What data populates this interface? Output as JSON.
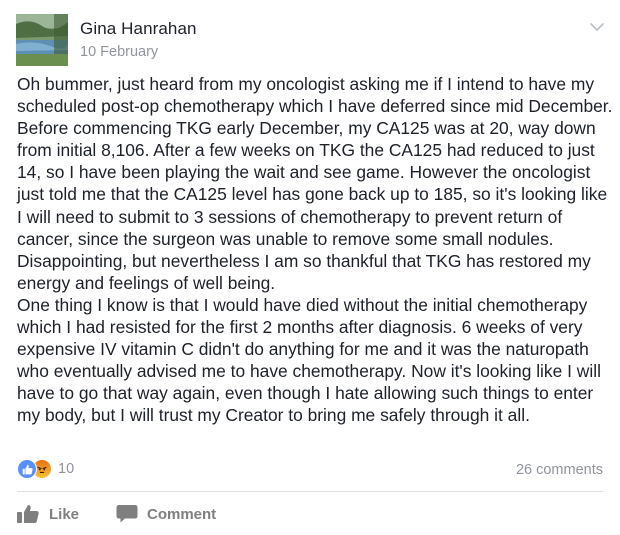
{
  "post": {
    "author": "Gina Hanrahan",
    "date": "10 February",
    "paragraphs": [
      "Oh bummer, just heard from my oncologist asking me if I intend to have my scheduled post-op chemotherapy which I have deferred since mid December. Before commencing TKG early December, my CA125 was at 20, way down from initial 8,106. After a few weeks on TKG the CA125 had reduced to just 14, so I have been playing the wait and see game. However the oncologist just told me that the CA125 level has gone back up to 185, so it's looking like I will need to submit to 3 sessions of chemotherapy to prevent return of cancer, since the surgeon was unable to remove some small nodules.",
      "Disappointing, but nevertheless I am so thankful that TKG has restored my energy and feelings of well being.",
      "One thing I know is that I would have died without the initial chemotherapy which I had resisted for the first 2 months after diagnosis. 6 weeks of very expensive IV vitamin C didn't do anything for me and it was the naturopath who eventually advised me to have chemotherapy. Now it's looking like I will have to go that way again, even though I hate allowing such things to enter my body, but I will trust my Creator to bring me safely through it all."
    ]
  },
  "reactions": {
    "icons": [
      "like-icon",
      "angry-icon"
    ],
    "count": "10"
  },
  "comments_count": "26 comments",
  "actions": {
    "like_label": "Like",
    "comment_label": "Comment"
  },
  "colors": {
    "like_blue": "#5890ff",
    "muted_text": "#90949c",
    "action_text": "#7f7f7f"
  }
}
